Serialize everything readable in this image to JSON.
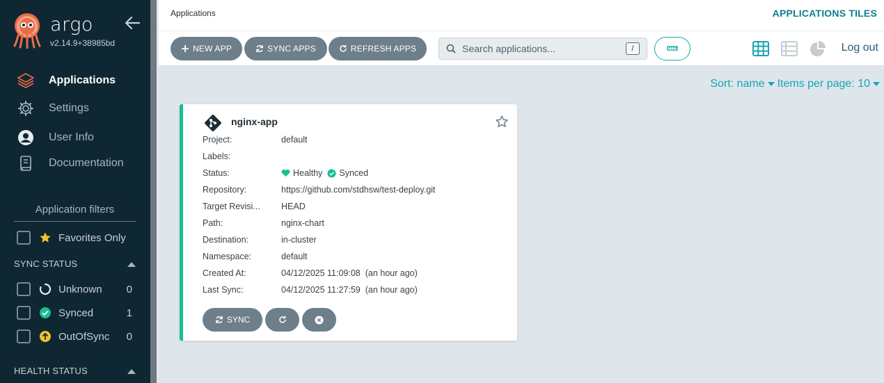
{
  "app": {
    "brand": "argo",
    "version": "v2.14.9+38985bd"
  },
  "nav": [
    {
      "label": "Applications",
      "icon": "layers-icon",
      "active": true
    },
    {
      "label": "Settings",
      "icon": "gear-icon"
    },
    {
      "label": "User Info",
      "icon": "user-icon"
    },
    {
      "label": "Documentation",
      "icon": "book-icon"
    }
  ],
  "filters": {
    "title": "Application filters",
    "favorites": "Favorites Only",
    "sync_status": {
      "title": "SYNC STATUS",
      "items": [
        {
          "label": "Unknown",
          "count": "0",
          "icon": "circle-notch-icon"
        },
        {
          "label": "Synced",
          "count": "1",
          "icon": "check-circle-icon"
        },
        {
          "label": "OutOfSync",
          "count": "0",
          "icon": "arrow-up-circle-icon"
        }
      ]
    },
    "health_status": {
      "title": "HEALTH STATUS"
    }
  },
  "header": {
    "breadcrumb": "Applications",
    "title": "APPLICATIONS TILES"
  },
  "toolbar": {
    "new_app": "NEW APP",
    "sync_apps": "SYNC APPS",
    "refresh_apps": "REFRESH APPS",
    "search_placeholder": "Search applications...",
    "search_shortcut": "/",
    "logout": "Log out"
  },
  "sort": {
    "sort_label": "Sort: name",
    "per_page_label": "Items per page: 10"
  },
  "colors": {
    "accent": "#1aa3b5",
    "healthy": "#18be94",
    "sidebar": "#0f2733",
    "button": "#6d7f8b"
  },
  "card": {
    "name": "nginx-app",
    "fields": [
      {
        "key": "Project:",
        "value": "default"
      },
      {
        "key": "Labels:",
        "value": ""
      },
      {
        "key": "Status:",
        "health": "Healthy",
        "sync": "Synced"
      },
      {
        "key": "Repository:",
        "value": "https://github.com/stdhsw/test-deploy.git"
      },
      {
        "key": "Target Revisi...",
        "value": "HEAD"
      },
      {
        "key": "Path:",
        "value": "nginx-chart"
      },
      {
        "key": "Destination:",
        "value": "in-cluster"
      },
      {
        "key": "Namespace:",
        "value": "default"
      },
      {
        "key": "Created At:",
        "value": "04/12/2025 11:09:08  (an hour ago)"
      },
      {
        "key": "Last Sync:",
        "value": "04/12/2025 11:27:59  (an hour ago)"
      }
    ],
    "sync_label": "SYNC"
  }
}
